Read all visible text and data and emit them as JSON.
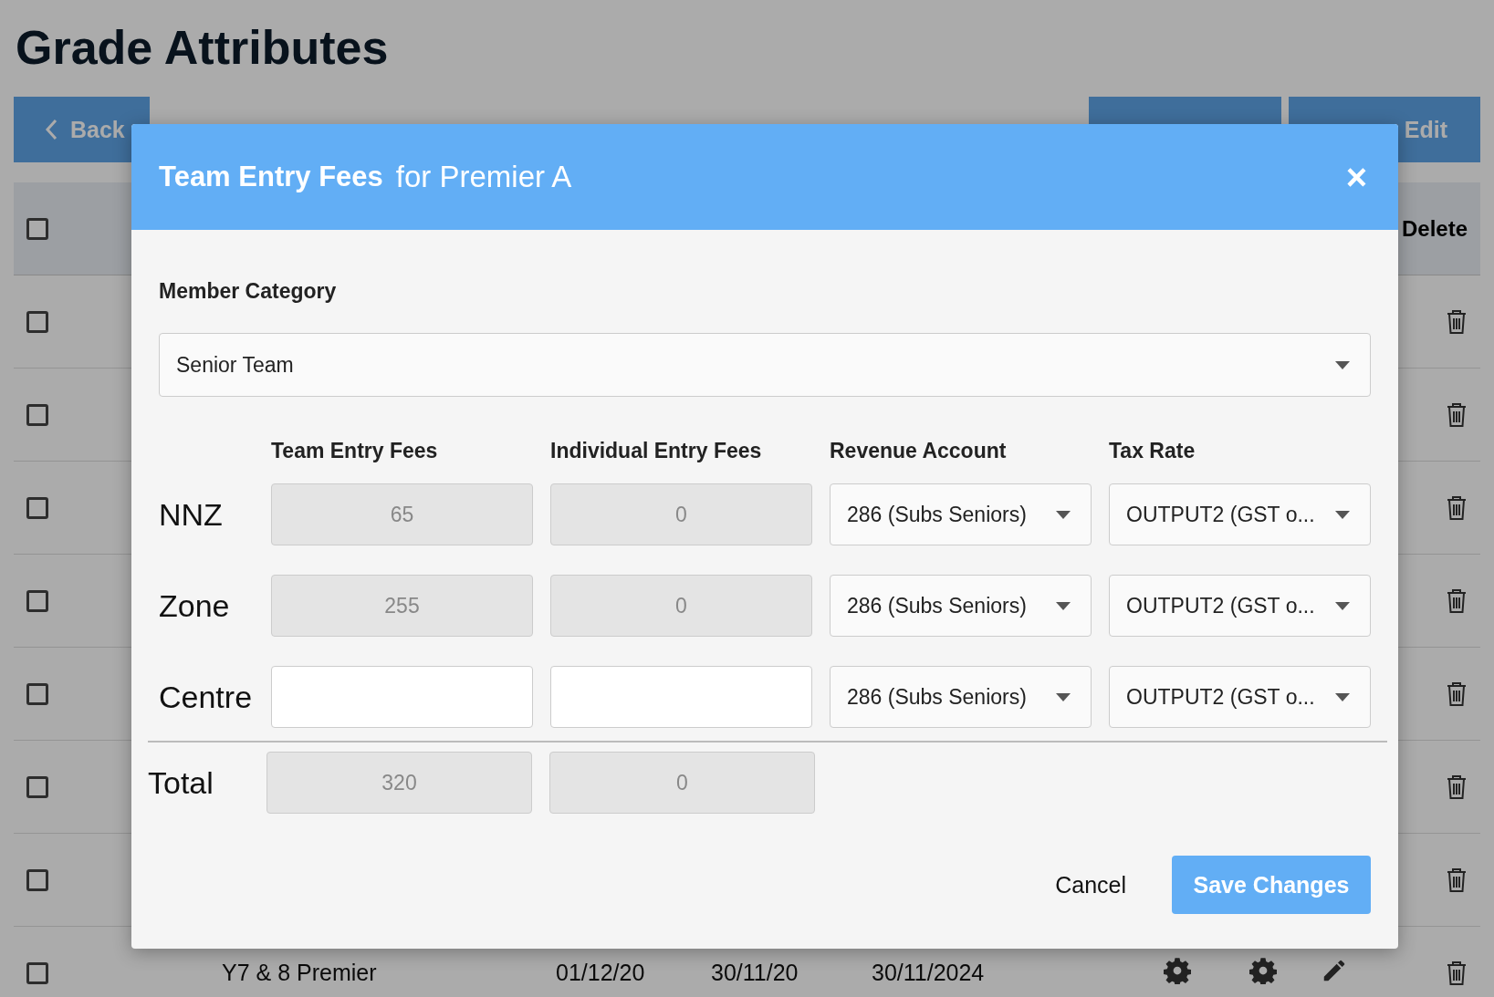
{
  "page": {
    "title": "Grade Attributes",
    "back_button": "Back",
    "header_buttons": [
      {
        "label": "Edit"
      }
    ]
  },
  "table": {
    "delete_heading": "Delete",
    "header_checked": false,
    "rows": [
      {
        "checked": false
      },
      {
        "checked": false
      },
      {
        "checked": false
      },
      {
        "checked": false
      },
      {
        "checked": false
      },
      {
        "checked": false
      },
      {
        "checked": false
      },
      {
        "checked": false,
        "name": "Y7 & 8 Premier",
        "column_2": "01/12/20",
        "column_3": "30/11/20",
        "column_4": "30/11/2024"
      }
    ]
  },
  "modal": {
    "title": "Team Entry Fees",
    "subtitle": "for Premier A",
    "close": "×",
    "member_category": {
      "label": "Member Category",
      "value": "Senior Team"
    },
    "columns": [
      "Team Entry Fees",
      "Individual Entry Fees",
      "Revenue Account",
      "Tax Rate"
    ],
    "rows": [
      {
        "label": "NNZ",
        "team_fee": "65",
        "individual_fee": "0",
        "disabled": true,
        "revenue_account": "286 (Subs Seniors)",
        "tax_rate": "OUTPUT2 (GST o..."
      },
      {
        "label": "Zone",
        "team_fee": "255",
        "individual_fee": "0",
        "disabled": true,
        "revenue_account": "286 (Subs Seniors)",
        "tax_rate": "OUTPUT2 (GST o..."
      },
      {
        "label": "Centre",
        "disabled": false,
        "revenue_account": "286 (Subs Seniors)",
        "tax_rate": "OUTPUT2 (GST o..."
      }
    ],
    "total": {
      "label": "Total",
      "team_fee": "320",
      "individual_fee": "0"
    },
    "buttons": {
      "cancel": "Cancel",
      "save": "Save Changes"
    }
  }
}
